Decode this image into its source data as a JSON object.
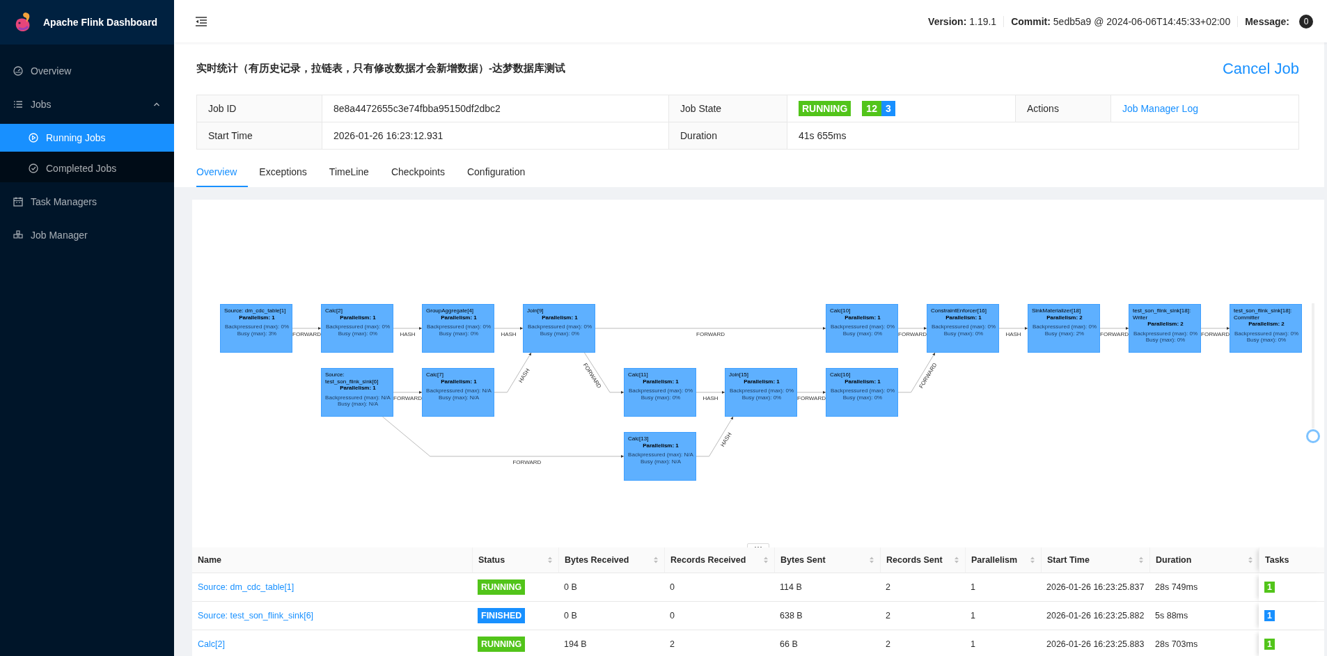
{
  "sidebar": {
    "title": "Apache Flink Dashboard",
    "items": [
      {
        "label": "Overview",
        "selected": false
      },
      {
        "label": "Jobs",
        "selected": false,
        "expanded": true,
        "children": [
          {
            "label": "Running Jobs",
            "selected": true
          },
          {
            "label": "Completed Jobs",
            "selected": false
          }
        ]
      },
      {
        "label": "Task Managers",
        "selected": false
      },
      {
        "label": "Job Manager",
        "selected": false
      }
    ]
  },
  "header": {
    "info": [
      {
        "label": "Version:",
        "value": "1.19.1"
      },
      {
        "label": "Commit:",
        "value": "5edb5a9 @ 2024-06-06T14:45:33+02:00"
      }
    ],
    "message_label": "Message:",
    "message_count": "0"
  },
  "job": {
    "title": "实时统计（有历史记录，拉链表，只有修改数据才会新增数据）-达梦数据库测试",
    "cancel": "Cancel Job",
    "details": [
      {
        "label": "Job ID",
        "value": "8e8a4472655c3e74fbba95150df2dbc2"
      },
      {
        "label": "Job State",
        "state": {
          "label": "RUNNING",
          "color": "#52c41a"
        },
        "counts": [
          {
            "count": "12",
            "color": "#52c41a"
          },
          {
            "count": "3",
            "color": "#1890ff"
          }
        ]
      },
      {
        "label": "Actions",
        "link": "Job Manager Log"
      },
      {
        "label": "Start Time",
        "value": "2026-01-26 16:23:12.931"
      },
      {
        "label": "Duration",
        "value": "41s 655ms"
      }
    ],
    "tabs": [
      {
        "label": "Overview",
        "selected": true
      },
      {
        "label": "Exceptions",
        "selected": false
      },
      {
        "label": "TimeLine",
        "selected": false
      },
      {
        "label": "Checkpoints",
        "selected": false
      },
      {
        "label": "Configuration",
        "selected": false
      }
    ]
  },
  "graph": {
    "nodes": [
      {
        "name": "Source: dm_cdc_table[1]",
        "parallelism": "Parallelism: 1",
        "backpressured": "Backpressured (max): 0%",
        "busy": "Busy (max): 3%"
      },
      {
        "name": "Calc[2]",
        "parallelism": "Parallelism: 1",
        "backpressured": "Backpressured (max): 0%",
        "busy": "Busy (max): 0%"
      },
      {
        "name": "GroupAggregate[4]",
        "parallelism": "Parallelism: 1",
        "backpressured": "Backpressured (max): 0%",
        "busy": "Busy (max): 0%"
      },
      {
        "name": "Join[9]",
        "parallelism": "Parallelism: 1",
        "backpressured": "Backpressured (max): 0%",
        "busy": "Busy (max): 0%"
      },
      {
        "name": "Calc[10]",
        "parallelism": "Parallelism: 1",
        "backpressured": "Backpressured (max): 0%",
        "busy": "Busy (max): 0%"
      },
      {
        "name": "ConstraintEnforcer[16]",
        "parallelism": "Parallelism: 1",
        "backpressured": "Backpressured (max): 0%",
        "busy": "Busy (max): 0%"
      },
      {
        "name": "SinkMaterializer[18]",
        "parallelism": "Parallelism: 2",
        "backpressured": "Backpressured (max): 0%",
        "busy": "Busy (max): 2%"
      },
      {
        "name": "test_son_flink_sink[18]: Writer",
        "parallelism": "Parallelism: 2",
        "backpressured": "Backpressured (max): 0%",
        "busy": "Busy (max): 0%"
      },
      {
        "name": "test_son_flink_sink[18]: Committer",
        "parallelism": "Parallelism: 2",
        "backpressured": "Backpressured (max): 0%",
        "busy": "Busy (max): 0%"
      },
      {
        "name": "Source: test_son_flink_sink[6]",
        "parallelism": "Parallelism: 1",
        "backpressured": "Backpressured (max): N/A",
        "busy": "Busy (max): N/A"
      },
      {
        "name": "Calc[7]",
        "parallelism": "Parallelism: 1",
        "backpressured": "Backpressured (max): N/A",
        "busy": "Busy (max): N/A"
      },
      {
        "name": "Calc[11]",
        "parallelism": "Parallelism: 1",
        "backpressured": "Backpressured (max): 0%",
        "busy": "Busy (max): 0%"
      },
      {
        "name": "Join[15]",
        "parallelism": "Parallelism: 1",
        "backpressured": "Backpressured (max): 0%",
        "busy": "Busy (max): 0%"
      },
      {
        "name": "Calc[16]",
        "parallelism": "Parallelism: 1",
        "backpressured": "Backpressured (max): 0%",
        "busy": "Busy (max): 0%"
      },
      {
        "name": "Calc[13]",
        "parallelism": "Parallelism: 1",
        "backpressured": "Backpressured (max): N/A",
        "busy": "Busy (max): N/A"
      }
    ],
    "edges": [
      {
        "label": "FORWARD"
      },
      {
        "label": "HASH"
      },
      {
        "label": "HASH"
      },
      {
        "label": "FORWARD"
      },
      {
        "label": "FORWARD"
      },
      {
        "label": "HASH"
      },
      {
        "label": "FORWARD"
      },
      {
        "label": "FORWARD"
      },
      {
        "label": "FORWARD"
      },
      {
        "label": "HASH"
      },
      {
        "label": "FORWARD"
      },
      {
        "label": "HASH"
      },
      {
        "label": "FORWARD"
      },
      {
        "label": "FORWARD"
      },
      {
        "label": "FORWARD"
      },
      {
        "label": "HASH"
      }
    ],
    "zoom": {
      "level": 0
    }
  },
  "vertices": {
    "columns": [
      {
        "label": "Name",
        "sortable": false
      },
      {
        "label": "Status",
        "sortable": true
      },
      {
        "label": "Bytes Received",
        "sortable": true
      },
      {
        "label": "Records Received",
        "sortable": true
      },
      {
        "label": "Bytes Sent",
        "sortable": true
      },
      {
        "label": "Records Sent",
        "sortable": true
      },
      {
        "label": "Parallelism",
        "sortable": true
      },
      {
        "label": "Start Time",
        "sortable": true
      },
      {
        "label": "Duration",
        "sortable": true
      },
      {
        "label": "Tasks",
        "sortable": false
      }
    ],
    "rows": [
      {
        "name": "Source: dm_cdc_table[1]",
        "status": {
          "label": "RUNNING",
          "color": "#52c41a"
        },
        "bytes_received": "0 B",
        "records_received": "0",
        "bytes_sent": "114 B",
        "records_sent": "2",
        "parallelism": "1",
        "start_time": "2026-01-26 16:23:25.837",
        "duration": "28s 749ms",
        "tasks": [
          {
            "count": "1",
            "color": "#52c41a"
          }
        ]
      },
      {
        "name": "Source: test_son_flink_sink[6]",
        "status": {
          "label": "FINISHED",
          "color": "#1890ff"
        },
        "bytes_received": "0 B",
        "records_received": "0",
        "bytes_sent": "638 B",
        "records_sent": "2",
        "parallelism": "1",
        "start_time": "2026-01-26 16:23:25.882",
        "duration": "5s 88ms",
        "tasks": [
          {
            "count": "1",
            "color": "#1890ff"
          }
        ]
      },
      {
        "name": "Calc[2]",
        "status": {
          "label": "RUNNING",
          "color": "#52c41a"
        },
        "bytes_received": "194 B",
        "records_received": "2",
        "bytes_sent": "66 B",
        "records_sent": "2",
        "parallelism": "1",
        "start_time": "2026-01-26 16:23:25.883",
        "duration": "28s 703ms",
        "tasks": [
          {
            "count": "1",
            "color": "#52c41a"
          }
        ]
      }
    ]
  }
}
